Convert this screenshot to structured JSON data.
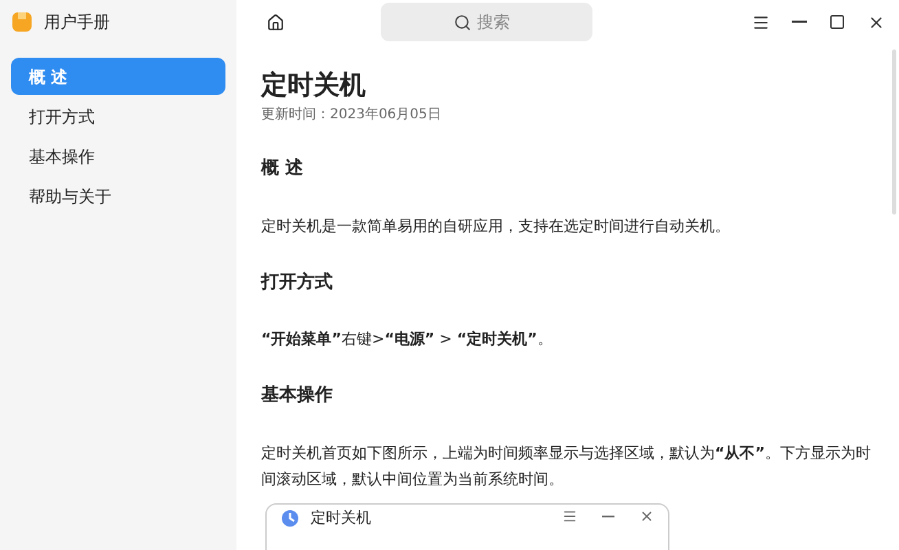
{
  "window": {
    "title": "用户手册"
  },
  "search": {
    "placeholder": "搜索"
  },
  "sidebar": {
    "items": [
      {
        "label": "概 述",
        "selected": true
      },
      {
        "label": "打开方式",
        "selected": false
      },
      {
        "label": "基本操作",
        "selected": false
      },
      {
        "label": "帮助与关于",
        "selected": false
      }
    ]
  },
  "article": {
    "title": "定时关机",
    "updated": "更新时间：2023年06月05日",
    "sections": [
      {
        "heading": "概 述",
        "text": "定时关机是一款简单易用的自研应用，支持在选定时间进行自动关机。"
      },
      {
        "heading": "打开方式",
        "text": "**“开始菜单”**右键>**“电源”** > **“定时关机”**。"
      },
      {
        "heading": "基本操作",
        "text": "定时关机首页如下图所示，上端为时间频率显示与选择区域，默认为**“从不”**。下方显示为时间滚动区域，默认中间位置为当前系统时间。"
      }
    ],
    "screenshot": {
      "title": "定时关机"
    }
  }
}
